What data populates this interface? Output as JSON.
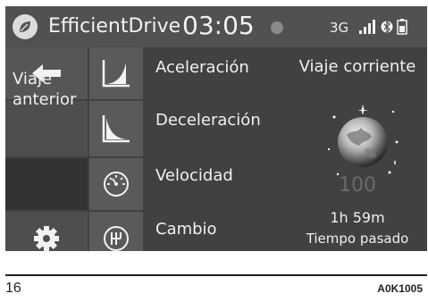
{
  "status_bar": {
    "app_name": "EfficientDrive",
    "clock": "03:05",
    "network": "3G",
    "icons": [
      "leaf-logo-icon",
      "leaf-status-icon",
      "signal-icon",
      "bluetooth-icon",
      "battery-icon"
    ]
  },
  "left_menu": {
    "back_icon": "back-arrow-icon",
    "prev_trip_lines": [
      "Viaje",
      "anterior"
    ],
    "settings_icon": "gear-icon"
  },
  "menu": {
    "items": [
      {
        "label": "Aceleración",
        "icon": "acceleration-graph-icon"
      },
      {
        "label": "Deceleración",
        "icon": "deceleration-graph-icon"
      },
      {
        "label": "Velocidad",
        "icon": "speedometer-icon"
      },
      {
        "label": "Cambio",
        "icon": "gear-shift-icon"
      }
    ]
  },
  "trip_panel": {
    "title": "Viaje corriente",
    "score": "100",
    "time": "1h 59m",
    "time_label": "Tiempo pasado"
  },
  "page_footer": {
    "page_number": "16",
    "code": "A0K1005"
  },
  "colors": {
    "screen_bg": "#414141",
    "status_bg": "#515151",
    "cell_bg": "#5a5a5a",
    "text": "#f0f0f0",
    "score_text": "#6a6a6a"
  }
}
